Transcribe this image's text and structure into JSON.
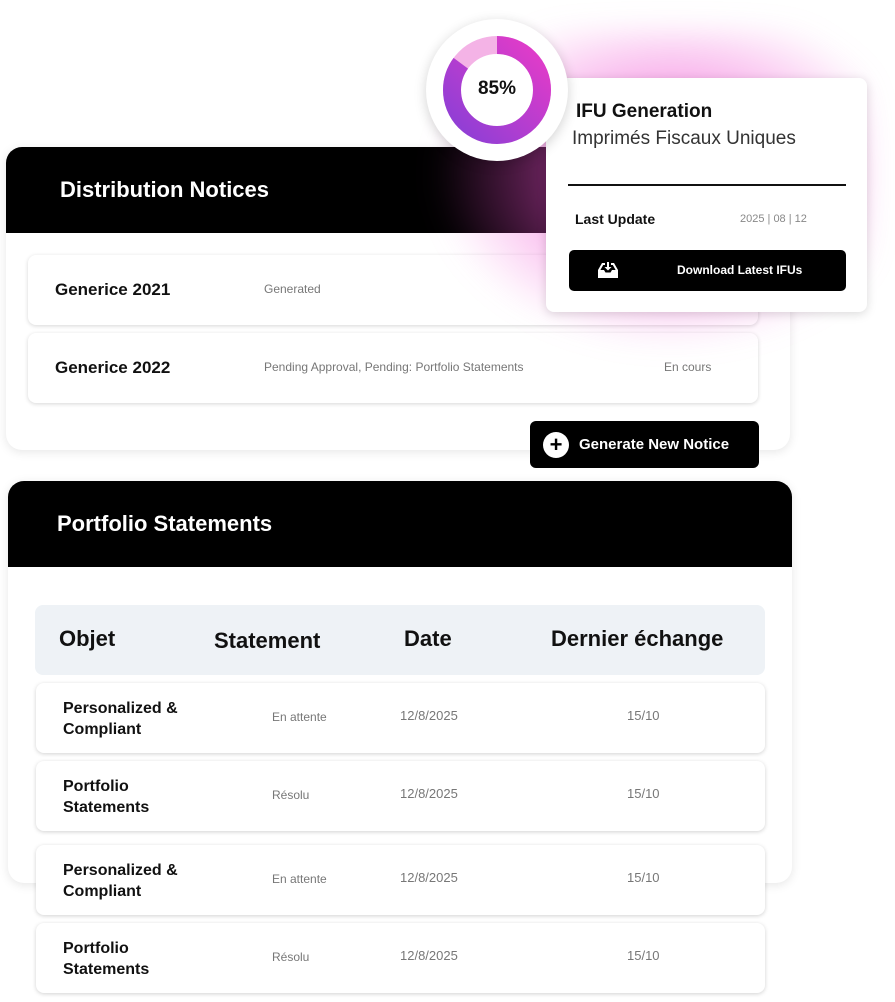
{
  "colors": {
    "accent": "#e63bc8",
    "accent_light": "#f4b3e6",
    "header_bg": "#000000",
    "table_head_bg": "#eef2f6"
  },
  "progress": {
    "value": 85,
    "label": "85%"
  },
  "ifu": {
    "title": "IFU Generation",
    "subtitle": "Imprimés Fiscaux Uniques",
    "last_update_label": "Last Update",
    "last_update_value": "2025 | 08 | 12",
    "download_icon": "inbox-download-icon",
    "download_label": "Download Latest IFUs"
  },
  "distribution": {
    "title": "Distribution Notices",
    "rows": [
      {
        "name": "Generice 2021",
        "status": "Generated",
        "progress": ""
      },
      {
        "name": "Generice 2022",
        "status": "Pending Approval, Pending: Portfolio Statements",
        "progress": "En cours"
      }
    ],
    "generate_icon": "plus-circle-icon",
    "generate_label": "Generate New Notice"
  },
  "portfolio": {
    "title": "Portfolio Statements",
    "columns": [
      "Objet",
      "Statement",
      "Date",
      "Dernier échange"
    ],
    "rows": [
      {
        "objet": "Personalized & Compliant",
        "statement": "En attente",
        "date": "12/8/2025",
        "last": "15/10"
      },
      {
        "objet": "Portfolio Statements",
        "statement": "Résolu",
        "date": "12/8/2025",
        "last": "15/10"
      },
      {
        "objet": "Personalized & Compliant",
        "statement": "En attente",
        "date": "12/8/2025",
        "last": "15/10"
      },
      {
        "objet": "Portfolio Statements",
        "statement": "Résolu",
        "date": "12/8/2025",
        "last": "15/10"
      }
    ]
  }
}
